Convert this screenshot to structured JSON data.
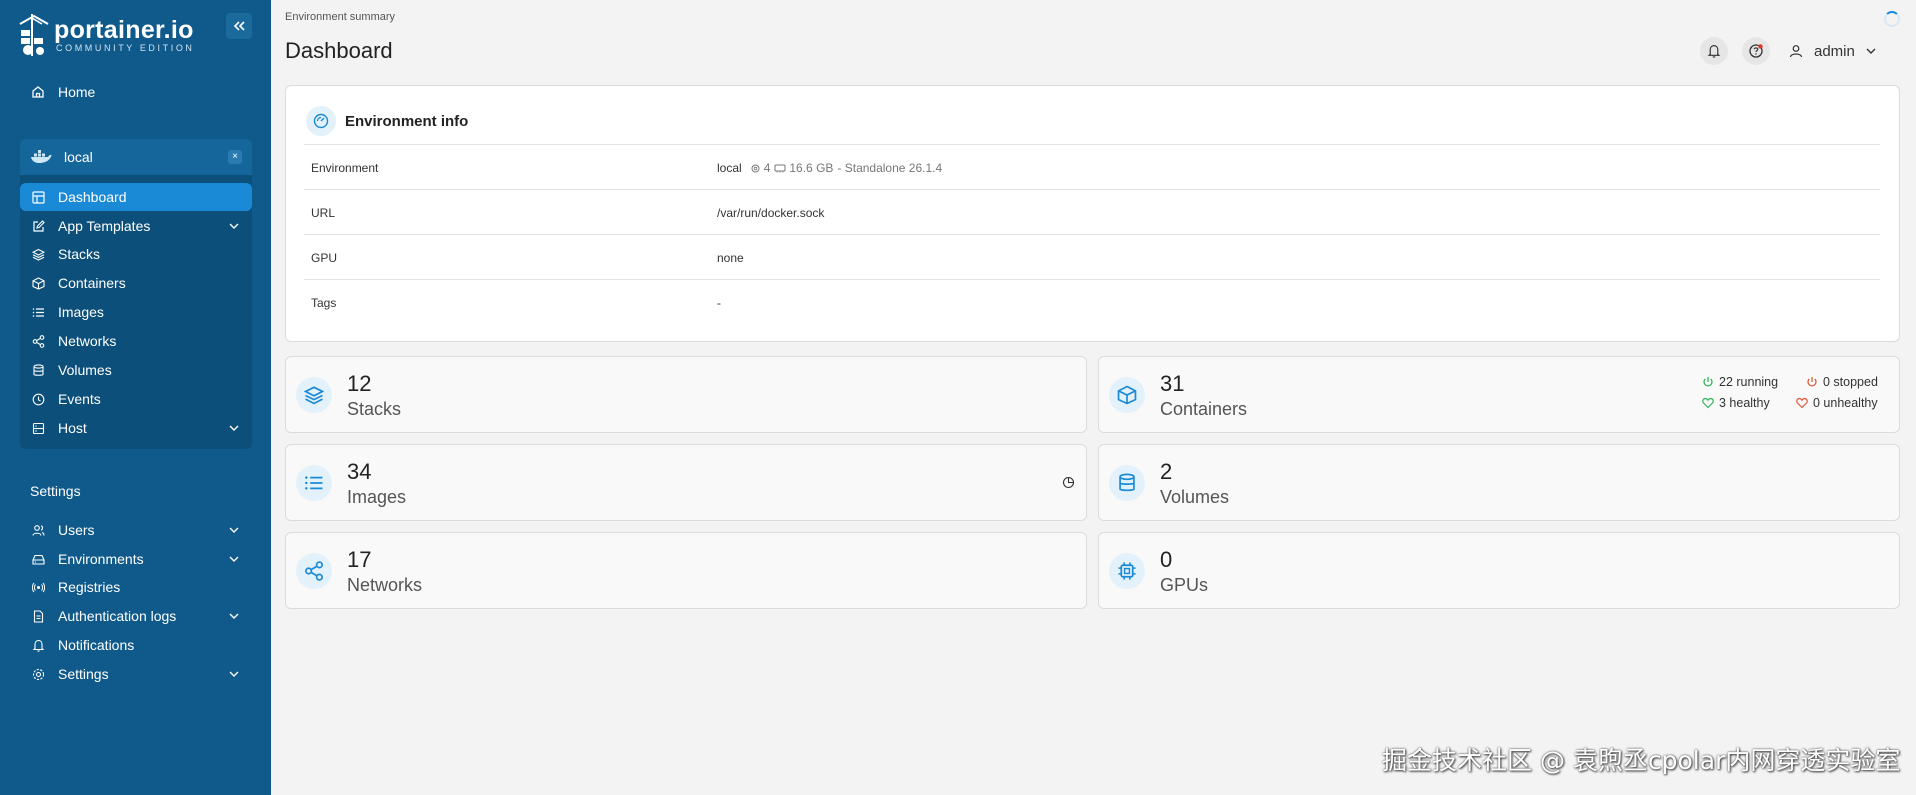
{
  "app": {
    "logo_main": "portainer.io",
    "logo_sub": "COMMUNITY EDITION"
  },
  "sidebar": {
    "home": "Home",
    "environment": {
      "name": "local",
      "close": "×",
      "items": [
        "Dashboard",
        "App Templates",
        "Stacks",
        "Containers",
        "Images",
        "Networks",
        "Volumes",
        "Events",
        "Host"
      ]
    },
    "settings_title": "Settings",
    "settings_items": [
      "Users",
      "Environments",
      "Registries",
      "Authentication logs",
      "Notifications",
      "Settings"
    ]
  },
  "header": {
    "breadcrumb": "Environment summary",
    "title": "Dashboard",
    "user": "admin"
  },
  "env_info": {
    "title": "Environment info",
    "rows": [
      {
        "key": "Environment",
        "value_name": "local",
        "cpu": "4",
        "memory": "16.6 GB",
        "version": "- Standalone 26.1.4"
      },
      {
        "key": "URL",
        "value": "/var/run/docker.sock"
      },
      {
        "key": "GPU",
        "value": "none"
      },
      {
        "key": "Tags",
        "value": "-"
      }
    ]
  },
  "stats": {
    "stacks": {
      "num": "12",
      "label": "Stacks"
    },
    "containers": {
      "num": "31",
      "label": "Containers",
      "running": "22 running",
      "stopped": "0 stopped",
      "healthy": "3 healthy",
      "unhealthy": "0 unhealthy"
    },
    "images": {
      "num": "34",
      "label": "Images"
    },
    "volumes": {
      "num": "2",
      "label": "Volumes"
    },
    "networks": {
      "num": "17",
      "label": "Networks"
    },
    "gpus": {
      "num": "0",
      "label": "GPUs"
    }
  },
  "watermark": "掘金技术社区 @ 袁煦丞cpolar内网穿透实验室",
  "colors": {
    "sidebar": "#0f5a8a",
    "active": "#1a8ad6",
    "accent": "#1a8ad6",
    "running": "#2fb55a",
    "stopped": "#e05a3a"
  }
}
